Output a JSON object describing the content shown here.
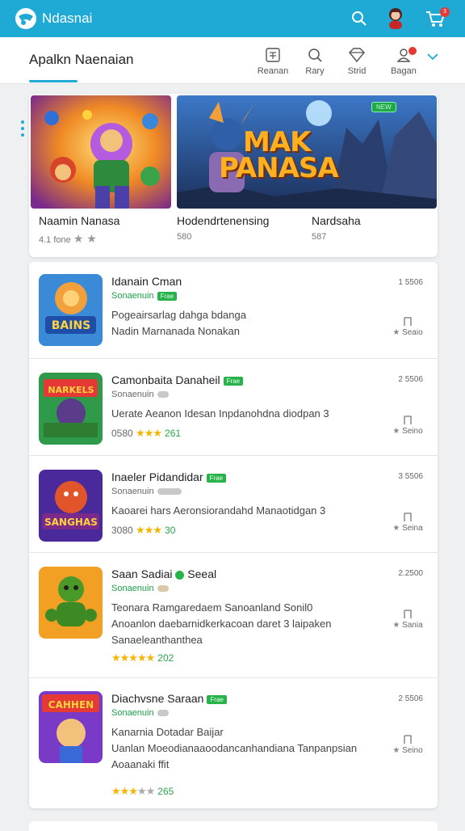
{
  "topbar": {
    "app_title": "Ndasnai",
    "cart_count": "3",
    "color": "#1eaad4"
  },
  "subheader": {
    "section_title": "Apalkn Naenaian",
    "nav": [
      {
        "label": "Reanan",
        "icon": "grid-doc-icon"
      },
      {
        "label": "Rary",
        "icon": "search-icon"
      },
      {
        "label": "Strid",
        "icon": "gem-icon"
      },
      {
        "label": "Bagan",
        "icon": "person-icon"
      }
    ]
  },
  "featured": {
    "tag": "NEW",
    "banner_title_line1": "MAK",
    "banner_title_line2": "PANASA",
    "items": [
      {
        "title": "Naamin Nanasa",
        "sub": "4.1 fone"
      },
      {
        "title": "Hodendrtenensing",
        "sub": "580"
      },
      {
        "title": "Nardsaha",
        "sub": "587"
      }
    ]
  },
  "list": [
    {
      "title": "Idanain Cman",
      "badge": "Frae",
      "sub": "Sonaenuin",
      "size": "1 5506",
      "desc": "Pogeairsarlag dahga bdanga\nNadin Marnanada Nonakan",
      "rating_text": "",
      "rating": "",
      "stars": 0,
      "action": "Seaio",
      "icon_text": "BAINS"
    },
    {
      "title": "Camonbaita Danaheil",
      "badge": "Frae",
      "sub": "Sonaenuin",
      "size": "2 5506",
      "desc": "Uerate Aeanon Idesan Inpdanohdna diodpan 3",
      "rating_text": "0580",
      "rating": "261",
      "stars": 3,
      "action": "Seino",
      "icon_text": "NARKELS"
    },
    {
      "title": "Inaeler Pidandidar",
      "badge": "Frae",
      "sub": "Sonaenuin",
      "size": "3 5506",
      "desc": "Kaoarei hars Aeronsiorandahd Manaotidgan 3",
      "rating_text": "3080",
      "rating": "30",
      "stars": 3,
      "action": "Seina",
      "icon_text": "SANGHAS"
    },
    {
      "title": "Saan Sadiai",
      "badge": "Seeal",
      "sub": "Sonaenuin",
      "size": "2.2500",
      "desc": "Teonara Ramgaredaem Sanoanland Sonil0\nAnoanlon daebarnidkerkacoan daret 3 laipaken\nSanaeleanthanthea",
      "rating_text": "",
      "rating": "202",
      "stars": 5,
      "action": "Sania",
      "icon_text": ""
    },
    {
      "title": "Diachvsne Saraan",
      "badge": "Frae",
      "sub": "Sonaenuin",
      "size": "2 5506",
      "desc": "Kanarnia Dotadar Baijar\nUanlan Moeodianaaoodancanhandiana Tanpanpsian\nAoaanaki ffit",
      "rating_text": "",
      "rating": "265",
      "stars": 3.5,
      "action": "Seino",
      "icon_text": "CAHHEN"
    }
  ]
}
